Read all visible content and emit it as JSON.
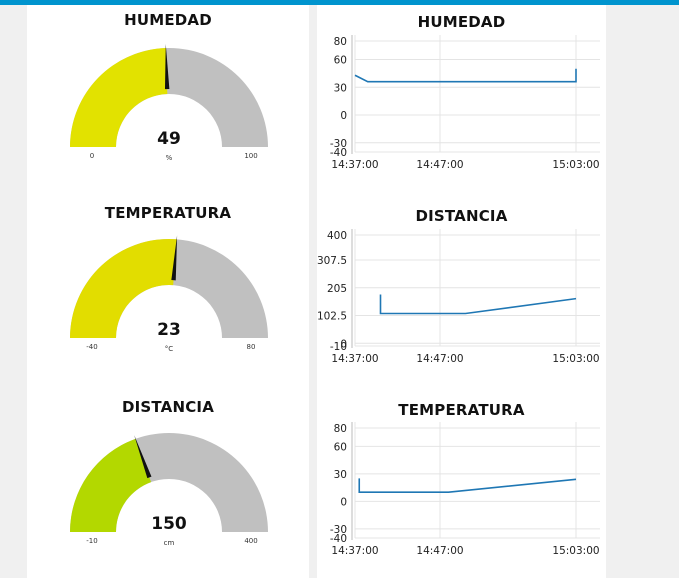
{
  "colors": {
    "topbar": "#0094ce",
    "gauge_track": "#c0c0c0",
    "needle": "#111111",
    "line": "#1f77b4",
    "grid": "#e4e4e4"
  },
  "gauges": [
    {
      "id": "humedad",
      "title": "HUMEDAD",
      "value": 49,
      "min": 0,
      "max": 100,
      "min_label": "0",
      "max_label": "100",
      "value_label": "49",
      "unit": "%",
      "color": "#e2e200"
    },
    {
      "id": "temperatura",
      "title": "TEMPERATURA",
      "value": 23,
      "min": -40,
      "max": 80,
      "min_label": "-40",
      "max_label": "80",
      "value_label": "23",
      "unit": "°C",
      "color": "#e2dd00"
    },
    {
      "id": "distancia",
      "title": "DISTANCIA",
      "value": 150,
      "min": -10,
      "max": 400,
      "min_label": "-10",
      "max_label": "400",
      "value_label": "150",
      "unit": "cm",
      "color": "#b3d800"
    }
  ],
  "chart_data": [
    {
      "type": "line",
      "title": "HUMEDAD",
      "x_ticks": [
        "14:37:00",
        "14:47:00",
        "15:03:00"
      ],
      "y_ticks": [
        "80",
        "60",
        "30",
        "0",
        "-30",
        "-40"
      ],
      "ylim": [
        -40,
        80
      ],
      "series": [
        {
          "points": [
            [
              "14:37:00",
              43
            ],
            [
              "14:38:30",
              36
            ],
            [
              "15:03:00",
              36
            ],
            [
              "15:03:00",
              50
            ]
          ]
        }
      ]
    },
    {
      "type": "line",
      "title": "DISTANCIA",
      "x_ticks": [
        "14:37:00",
        "14:47:00",
        "15:03:00"
      ],
      "y_ticks": [
        "400",
        "307.5",
        "205",
        "102.5",
        "0",
        "-10"
      ],
      "ylim": [
        -10,
        400
      ],
      "series": [
        {
          "points": [
            [
              "14:40:00",
              180
            ],
            [
              "14:40:00",
              110
            ],
            [
              "14:50:00",
              110
            ],
            [
              "15:03:00",
              165
            ]
          ]
        }
      ]
    },
    {
      "type": "line",
      "title": "TEMPERATURA",
      "x_ticks": [
        "14:37:00",
        "14:47:00",
        "15:03:00"
      ],
      "y_ticks": [
        "80",
        "60",
        "30",
        "0",
        "-30",
        "-40"
      ],
      "ylim": [
        -40,
        80
      ],
      "series": [
        {
          "points": [
            [
              "14:37:30",
              25
            ],
            [
              "14:37:30",
              10
            ],
            [
              "14:48:00",
              10
            ],
            [
              "15:03:00",
              24
            ]
          ]
        }
      ]
    }
  ]
}
